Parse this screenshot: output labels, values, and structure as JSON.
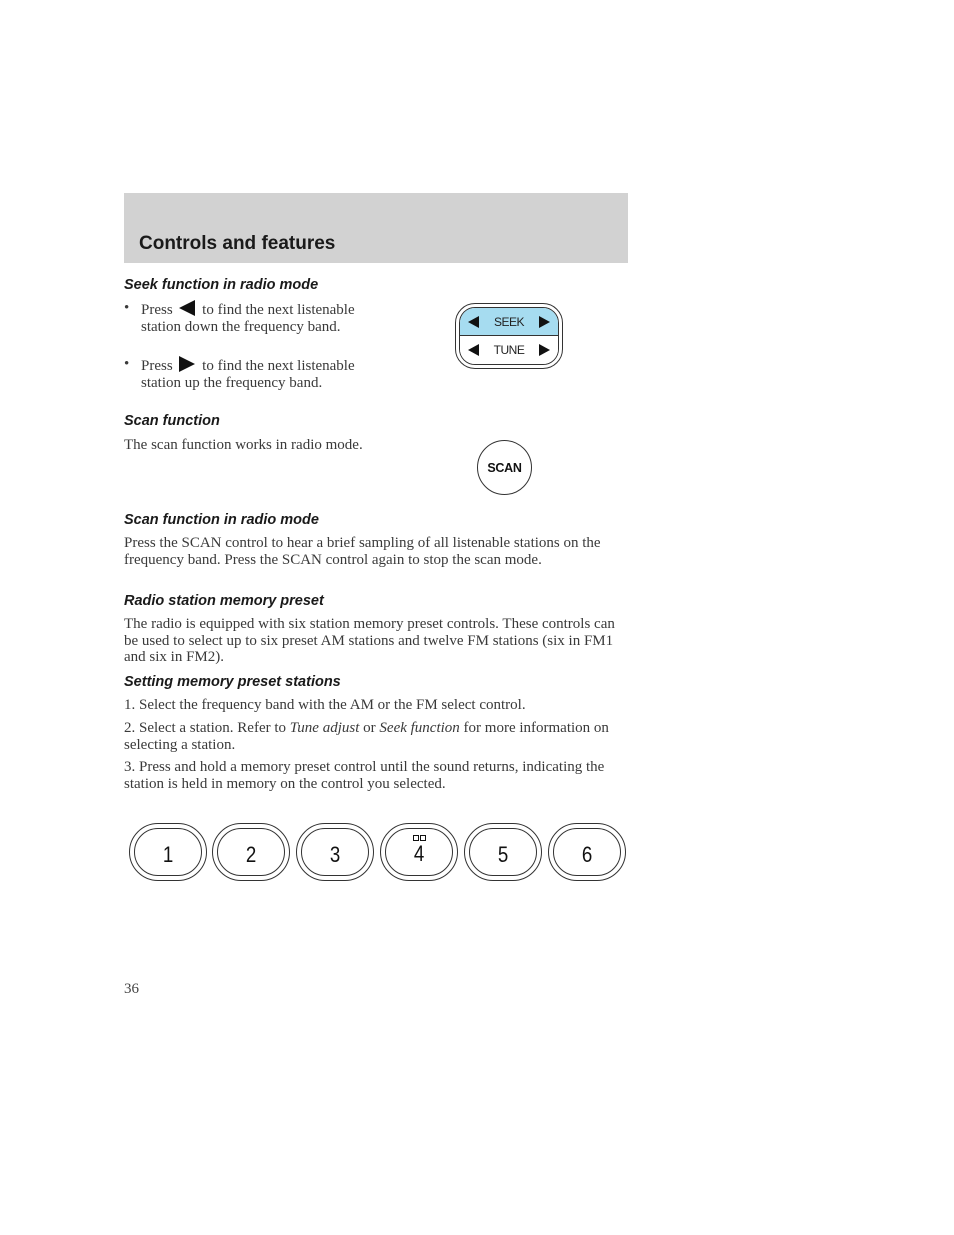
{
  "header": {
    "title": "Controls and features"
  },
  "sections": {
    "seek": {
      "heading": "Seek function in radio mode",
      "bullets": [
        {
          "pre": "Press",
          "icon": "seek-left-arrow",
          "post": "to find the next listenable station down the frequency band."
        },
        {
          "pre": "Press",
          "icon": "seek-right-arrow",
          "post": "to find the next listenable station up the frequency band."
        }
      ]
    },
    "scan": {
      "heading": "Scan function",
      "body": "The scan function works in radio mode."
    },
    "scan_radio": {
      "heading": "Scan function in radio mode",
      "body": "Press the SCAN control to hear a brief sampling of all listenable stations on the frequency band. Press the SCAN control again to stop the scan mode."
    },
    "memory": {
      "heading": "Radio station memory preset",
      "body": "The radio is equipped with six station memory preset controls. These controls can be used to select up to six preset AM stations and twelve FM stations (six in FM1 and six in FM2)."
    },
    "setting": {
      "heading": "Setting memory preset stations",
      "step1": "1. Select the frequency band with the AM or the FM select control.",
      "step2_pre": "2. Select a station. Refer to ",
      "step2_link1": "Tune adjust",
      "step2_mid": " or ",
      "step2_link2": "Seek function",
      "step2_post": " for more information on selecting a station.",
      "step3": "3. Press and hold a memory preset control until the sound returns, indicating the station is held in memory on the control you selected."
    }
  },
  "controls": {
    "seek_label": "SEEK",
    "tune_label": "TUNE",
    "seek_highlight_color": "#a6dcf0",
    "scan_label": "SCAN",
    "presets": [
      "1",
      "2",
      "3",
      "4",
      "5",
      "6"
    ]
  },
  "footer": {
    "page_number": "36"
  }
}
